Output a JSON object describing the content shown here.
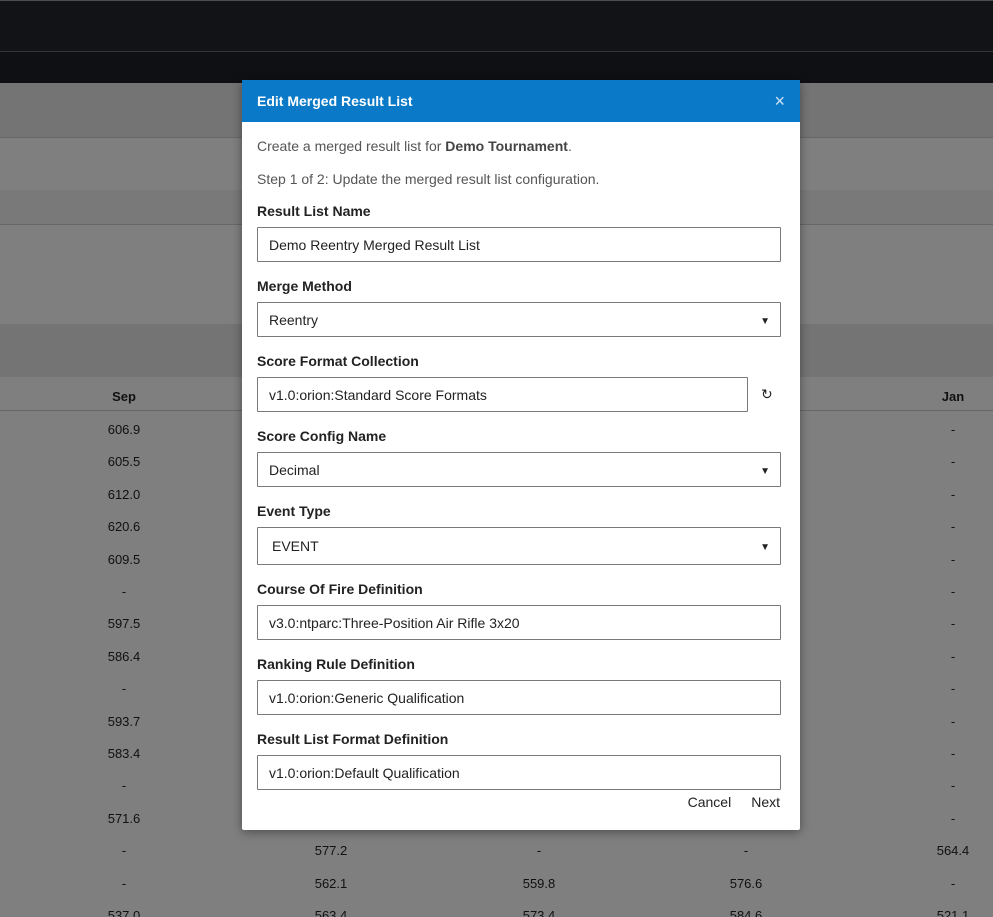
{
  "background": {
    "columns": [
      "Sep",
      "Jan"
    ],
    "sep_values": [
      "606.9",
      "605.5",
      "612.0",
      "620.6",
      "609.5",
      "-",
      "597.5",
      "586.4",
      "-",
      "593.7",
      "583.4",
      "-",
      "571.6"
    ],
    "jan_values": [
      "-",
      "-",
      "-",
      "-",
      "-",
      "-",
      "-",
      "-",
      "-",
      "-",
      "-",
      "-",
      "-"
    ],
    "bottom_rows": [
      [
        "-",
        "577.2",
        "-",
        "-",
        "564.4"
      ],
      [
        "-",
        "562.1",
        "559.8",
        "576.6",
        "-"
      ],
      [
        "537.0",
        "563.4",
        "573.4",
        "584.6",
        "521.1"
      ]
    ]
  },
  "modal": {
    "title": "Edit Merged Result List",
    "close_symbol": "×",
    "intro_prefix": "Create a merged result list for ",
    "tournament_name": "Demo Tournament",
    "intro_suffix": ".",
    "step_text": "Step 1 of 2: Update the merged result list configuration.",
    "fields": {
      "result_list_name": {
        "label": "Result List Name",
        "value": "Demo Reentry Merged Result List"
      },
      "merge_method": {
        "label": "Merge Method",
        "value": "Reentry"
      },
      "score_format_collection": {
        "label": "Score Format Collection",
        "value": "v1.0:orion:Standard Score Formats"
      },
      "score_config_name": {
        "label": "Score Config Name",
        "value": "Decimal"
      },
      "event_type": {
        "label": "Event Type",
        "value": "EVENT"
      },
      "course_of_fire": {
        "label": "Course Of Fire Definition",
        "value": "v3.0:ntparc:Three-Position Air Rifle 3x20"
      },
      "ranking_rule": {
        "label": "Ranking Rule Definition",
        "value": "v1.0:orion:Generic Qualification"
      },
      "result_list_format": {
        "label": "Result List Format Definition",
        "value": "v1.0:orion:Default Qualification"
      }
    },
    "caret_symbol": "▼",
    "refresh_symbol": "↻",
    "cancel_label": "Cancel",
    "next_label": "Next"
  },
  "colors": {
    "header_blue": "#0a79c7",
    "nav_dark": "#25272c"
  }
}
